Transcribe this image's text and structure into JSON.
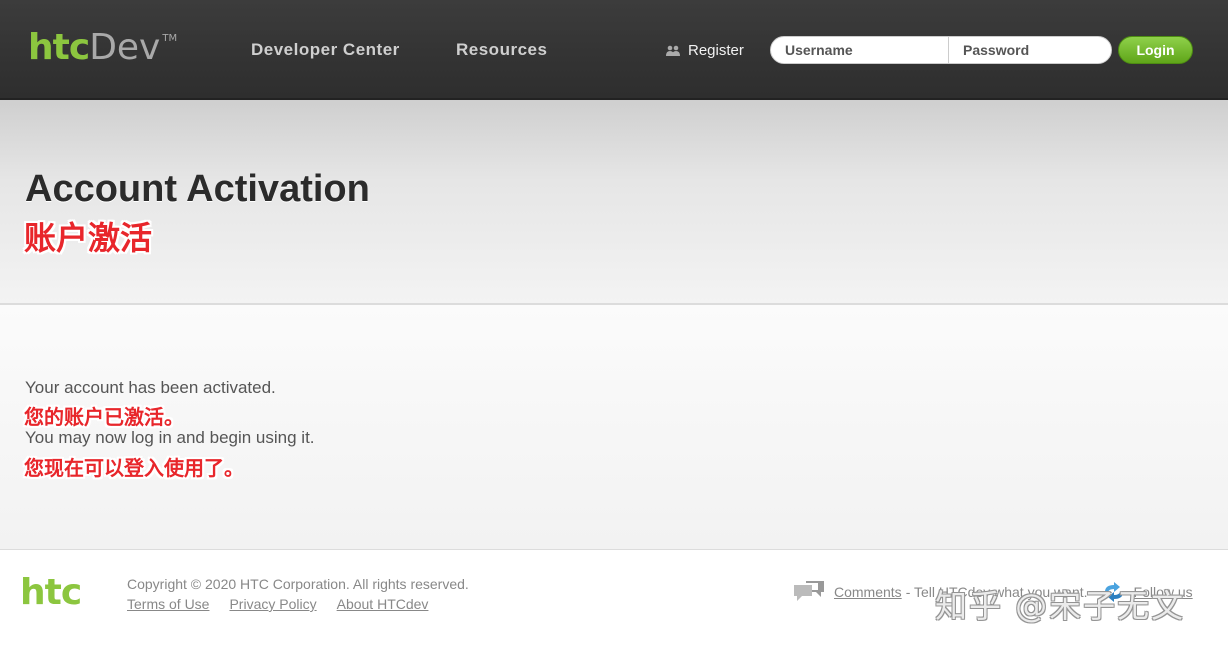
{
  "header": {
    "logo_htc": "htc",
    "logo_dev": "Dev",
    "logo_tm": "TM",
    "nav": [
      {
        "label": "Developer Center"
      },
      {
        "label": "Resources"
      }
    ],
    "register_label": "Register",
    "username_placeholder": "Username",
    "password_placeholder": "Password",
    "login_label": "Login"
  },
  "title": {
    "text": "Account Activation",
    "cn": "账户激活"
  },
  "content": {
    "line1": "Your account has been activated.",
    "line1_cn": "您的账户已激活。",
    "line2": "You may now log in and begin using it.",
    "line2_cn": "您现在可以登入使用了。"
  },
  "footer": {
    "logo": "htc",
    "copyright": "Copyright © 2020 HTC Corporation. All rights reserved.",
    "links": [
      "Terms of Use",
      "Privacy Policy",
      "About HTCdev"
    ],
    "comments_label": "Comments",
    "tell_text": "- Tell HTCdev what you want.",
    "follow_label": "Follow us",
    "watermark": "知乎 @宋子无文"
  },
  "colors": {
    "brand_green": "#8cc63f",
    "annotation_red": "#e8262b",
    "header_bg": "#333333"
  }
}
